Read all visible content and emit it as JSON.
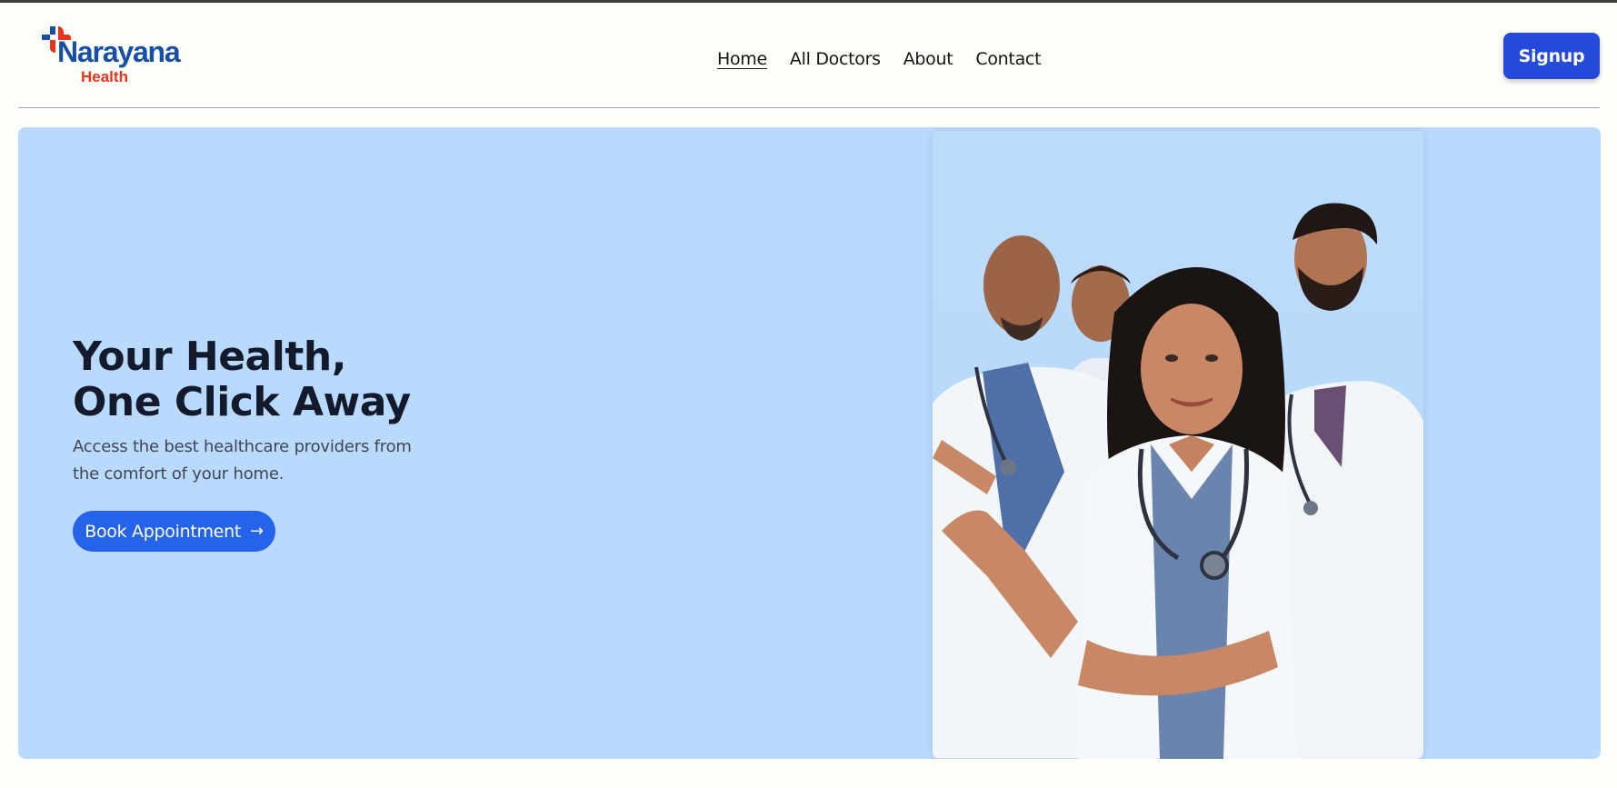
{
  "header": {
    "logo": {
      "name": "Narayana",
      "sub": "Health",
      "colors": {
        "primary": "#174ea6",
        "accent": "#e8341c"
      }
    },
    "nav": [
      {
        "label": "Home",
        "active": true
      },
      {
        "label": "All Doctors",
        "active": false
      },
      {
        "label": "About",
        "active": false
      },
      {
        "label": "Contact",
        "active": false
      }
    ],
    "signup_label": "Signup"
  },
  "hero": {
    "title_line1": "Your Health,",
    "title_line2": "One Click Away",
    "description": "Access the best healthcare providers from the comfort of your home.",
    "cta_label": "Book Appointment",
    "cta_icon": "arrow-right-icon",
    "background": "#badafd",
    "image_subject": "group of doctors in white coats with stethoscopes"
  },
  "colors": {
    "primary_button": "#2549d8",
    "cta_button": "#2563eb",
    "divider": "#9aa0e0",
    "page_background": "#fefefb"
  }
}
